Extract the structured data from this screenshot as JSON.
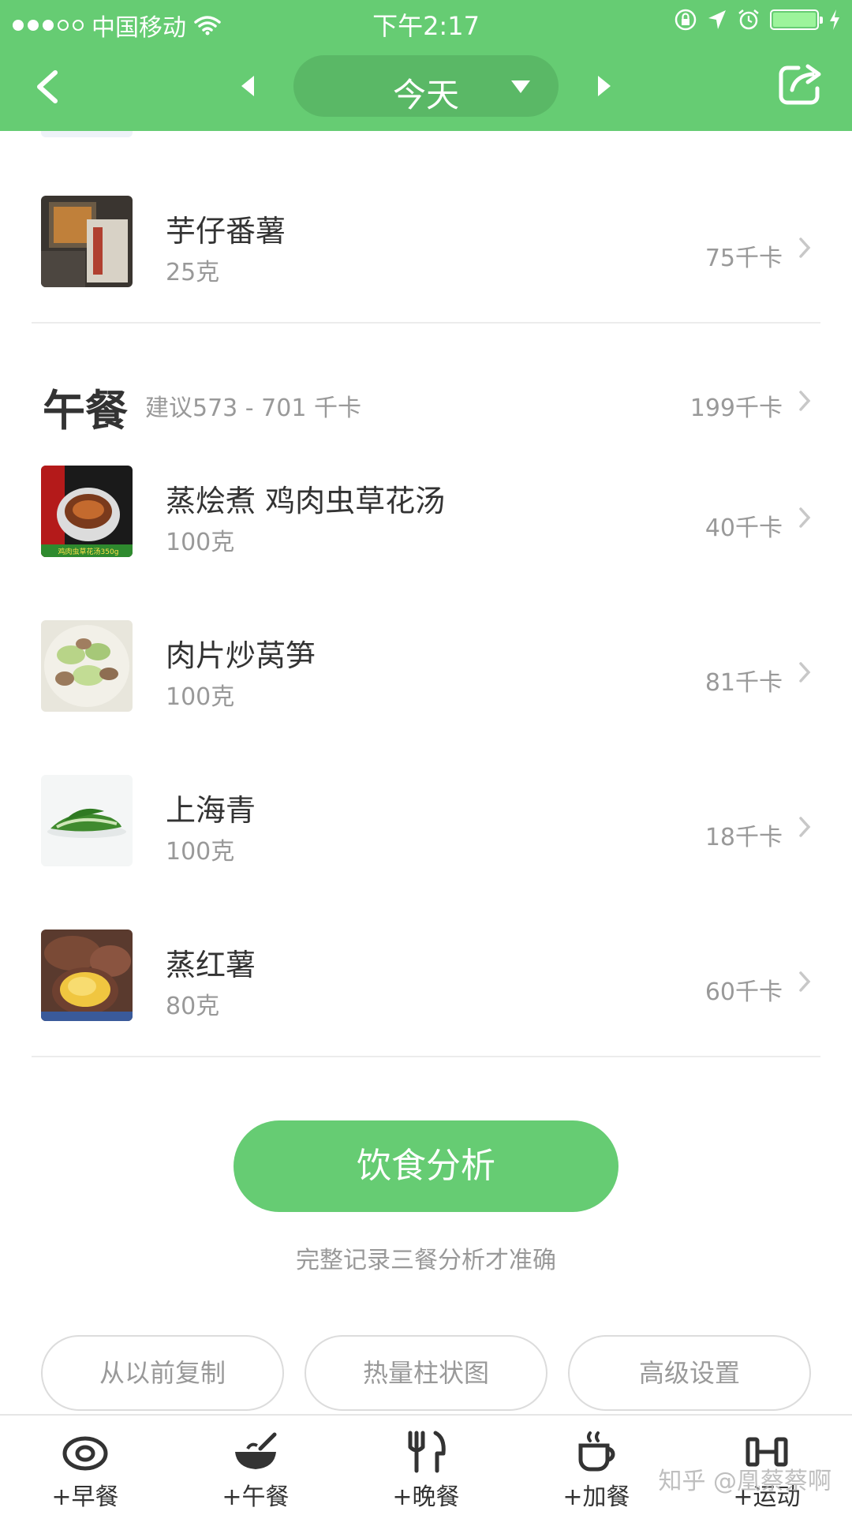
{
  "status_bar": {
    "carrier": "中国移动",
    "time": "下午2:17"
  },
  "nav": {
    "date_label": "今天"
  },
  "items_before": [
    {
      "name": "芋仔番薯",
      "amount": "25克",
      "calories": "75千卡"
    }
  ],
  "meal": {
    "title": "午餐",
    "suggestion": "建议573 - 701 千卡",
    "total": "199千卡",
    "items": [
      {
        "name": "蒸烩煮 鸡肉虫草花汤",
        "amount": "100克",
        "calories": "40千卡",
        "thumb_caption": "鸡肉虫草花汤350g"
      },
      {
        "name": "肉片炒莴笋",
        "amount": "100克",
        "calories": "81千卡"
      },
      {
        "name": "上海青",
        "amount": "100克",
        "calories": "18千卡"
      },
      {
        "name": "蒸红薯",
        "amount": "80克",
        "calories": "60千卡"
      }
    ]
  },
  "analysis": {
    "button_label": "饮食分析",
    "hint": "完整记录三餐分析才准确"
  },
  "actions": [
    {
      "label": "从以前复制"
    },
    {
      "label": "热量柱状图"
    },
    {
      "label": "高级设置"
    }
  ],
  "tabs": [
    {
      "label": "+早餐",
      "icon": "egg-icon"
    },
    {
      "label": "+午餐",
      "icon": "bowl-icon"
    },
    {
      "label": "+晚餐",
      "icon": "fork-knife-icon"
    },
    {
      "label": "+加餐",
      "icon": "coffee-cup-icon"
    },
    {
      "label": "+运动",
      "icon": "dumbbell-icon"
    }
  ],
  "watermark": "知乎 @凰蔡蔡啊",
  "colors": {
    "brand_green": "#66cc73",
    "pill_green": "#5ab866",
    "muted_text": "#999999"
  }
}
